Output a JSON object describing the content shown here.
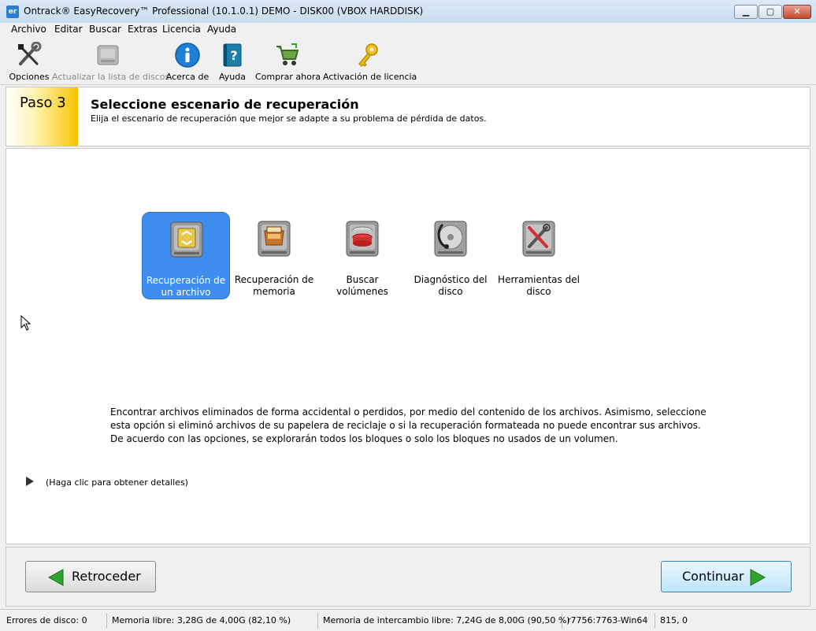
{
  "window": {
    "app_icon_text": "er",
    "title": "Ontrack® EasyRecovery™ Professional (10.1.0.1) DEMO - DISK00 (VBOX HARDDISK)",
    "minimize_glyph": "▁",
    "maximize_glyph": "▢",
    "close_glyph": "✕"
  },
  "menu": [
    "Archivo",
    "Editar",
    "Buscar",
    "Extras",
    "Licencia",
    "Ayuda"
  ],
  "toolbar": [
    {
      "label": "Opciones",
      "icon": "tools-icon",
      "enabled": true
    },
    {
      "label": "Actualizar la lista de discos",
      "icon": "disk-refresh-icon",
      "enabled": false
    },
    {
      "label": "Acerca de",
      "icon": "info-icon",
      "enabled": true
    },
    {
      "label": "Ayuda",
      "icon": "help-book-icon",
      "enabled": true
    },
    {
      "label": "Comprar ahora",
      "icon": "shopping-cart-icon",
      "enabled": true
    },
    {
      "label": "Activación de licencia",
      "icon": "key-icon",
      "enabled": true
    }
  ],
  "step": {
    "badge": "Paso 3",
    "title": "Seleccione escenario de recuperación",
    "subtitle": "Elija el escenario de recuperación que mejor se adapte a su problema de pérdida de datos."
  },
  "scenarios": [
    {
      "line1": "Recuperación de",
      "line2": "un archivo",
      "icon": "file-recovery-icon",
      "selected": true
    },
    {
      "line1": "Recuperación de",
      "line2": "memoria",
      "icon": "memory-recovery-icon",
      "selected": false
    },
    {
      "line1": "Buscar",
      "line2": "volúmenes",
      "icon": "volume-search-icon",
      "selected": false
    },
    {
      "line1": "Diagnóstico del",
      "line2": "disco",
      "icon": "disk-diagnostic-icon",
      "selected": false
    },
    {
      "line1": "Herramientas del",
      "line2": "disco",
      "icon": "disk-tools-icon",
      "selected": false
    }
  ],
  "description": "Encontrar archivos eliminados de forma accidental o perdidos, por medio del contenido de los archivos. Asimismo, seleccione esta opción si eliminó archivos de su papelera de reciclaje o si la recuperación formateada no puede encontrar sus archivos. De acuerdo con las opciones, se explorarán todos los bloques o solo los bloques no usados de un volumen.",
  "details_text": "(Haga clic para obtener detalles)",
  "nav": {
    "back_label": "Retroceder",
    "next_label": "Continuar"
  },
  "status": {
    "disk_errors": "Errores de disco: 0",
    "free_memory": "Memoria libre: 3,28G de 4,00G (82,10 %)",
    "swap_memory": "Memoria de intercambio libre: 7,24G de 8,00G (90,50 %)",
    "build": "r7756:7763-Win64",
    "coords": "815, 0"
  },
  "colors": {
    "selection": "#3e8ef0",
    "step_badge": "#f7c400",
    "arrow_green": "#2ea32e"
  }
}
